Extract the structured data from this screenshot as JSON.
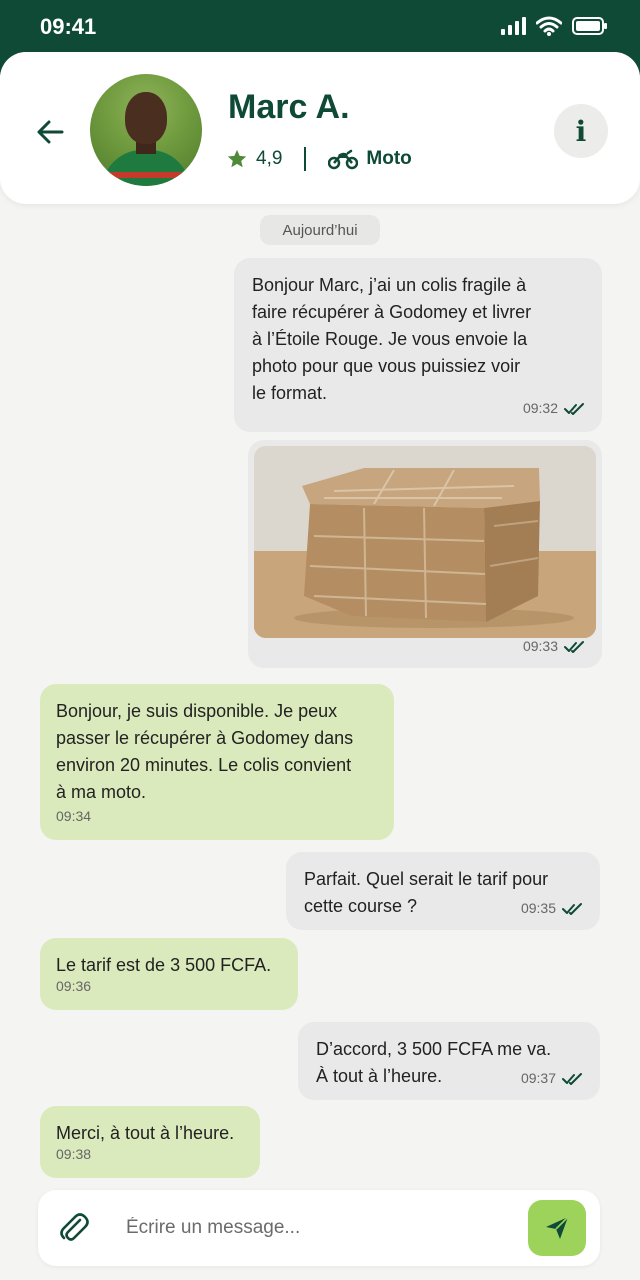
{
  "status_bar": {
    "time": "09:41"
  },
  "header": {
    "name": "Marc A.",
    "rating": "4,9",
    "vehicle": "Moto"
  },
  "date_chip": "Aujourd’hui",
  "messages": [
    {
      "text": "Bonjour Marc, j’ai un colis fragile à\nfaire récupérer à Godomey et livrer\nà l’Étoile Rouge. Je vous envoie la\nphoto pour que vous puissiez voir\nle format.",
      "time": "09:32",
      "direction": "out"
    },
    {
      "type": "image",
      "image": "cardboard-box-photo",
      "time": "09:33",
      "direction": "out"
    },
    {
      "text": "Bonjour, je suis disponible. Je peux\npasser le récupérer à Godomey dans\nenviron 20 minutes. Le colis convient\nà ma moto.",
      "time": "09:34",
      "direction": "in"
    },
    {
      "text": "Parfait. Quel serait le tarif pour\ncette course ?",
      "time": "09:35",
      "direction": "out"
    },
    {
      "text": "Le tarif est de 3 500 FCFA.",
      "time": "09:36",
      "direction": "in"
    },
    {
      "text": "D’accord, 3 500 FCFA me va.\nÀ tout à l’heure.",
      "time": "09:37",
      "direction": "out"
    },
    {
      "text": "Merci, à tout à l’heure.",
      "time": "09:38",
      "direction": "in"
    }
  ],
  "composer": {
    "placeholder": "Écrire un message..."
  },
  "colors": {
    "brand_dark_green": "#0f4a37",
    "incoming_bubble": "#dbeabc",
    "outgoing_bubble": "#e9e9e9",
    "send_button": "#9ed35b",
    "star": "#4f8a3a"
  },
  "icons": [
    "back-arrow-icon",
    "star-icon",
    "motorcycle-icon",
    "info-icon",
    "double-check-icon",
    "paperclip-icon",
    "send-icon",
    "signal-icon",
    "wifi-icon",
    "battery-icon"
  ]
}
